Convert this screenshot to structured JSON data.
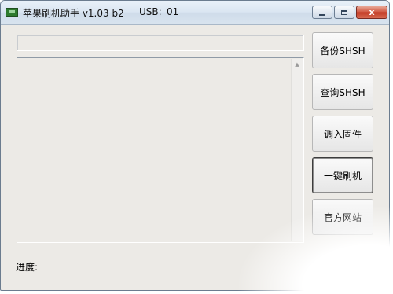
{
  "window": {
    "title": "苹果刷机助手 v1.03 b2",
    "usb_label": "USB:",
    "usb_value": "01"
  },
  "controls": {
    "close_glyph": "x"
  },
  "buttons": {
    "backup": "备份SHSH",
    "query": "查询SHSH",
    "load_firmware": "调入固件",
    "flash": "一键刷机",
    "website": "官方网站"
  },
  "status": {
    "progress_label": "进度:"
  },
  "icons": {
    "app": "app-icon",
    "minimize": "minimize-icon",
    "maximize": "maximize-icon",
    "close": "close-icon",
    "scroll_up": "chevron-up-icon"
  }
}
